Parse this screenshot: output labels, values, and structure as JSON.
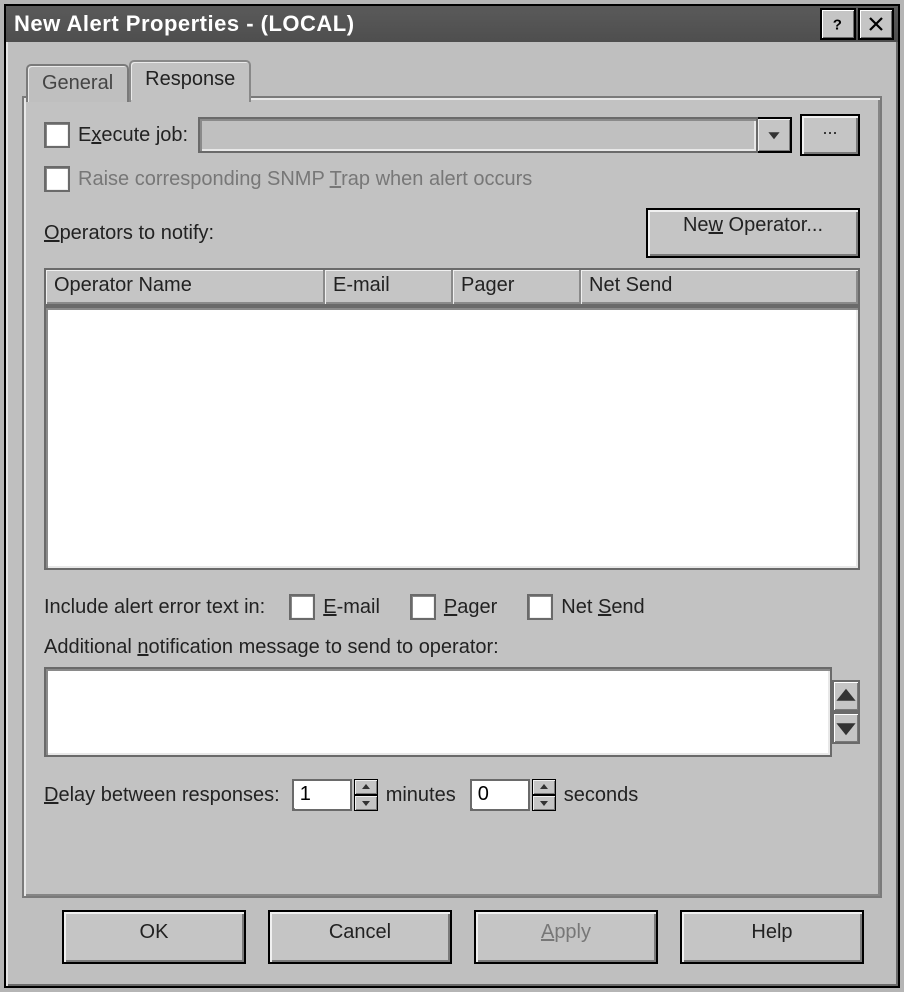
{
  "window": {
    "title": "New Alert Properties - (LOCAL)"
  },
  "tabs": {
    "general": "General",
    "response": "Response"
  },
  "response": {
    "execute_label": "Execute job:",
    "execute_value": "",
    "browse_label": "...",
    "snmp_label": "Raise corresponding SNMP Trap when alert occurs",
    "operators_label": "Operators to notify:",
    "new_operator_btn": "New Operator...",
    "columns": {
      "name": "Operator Name",
      "email": "E-mail",
      "pager": "Pager",
      "netsend": "Net Send"
    },
    "include_label": "Include alert error text in:",
    "include_email": "E-mail",
    "include_pager": "Pager",
    "include_netsend": "Net Send",
    "addl_msg_label": "Additional notification message to send to operator:",
    "addl_msg_value": "",
    "delay_label": "Delay between responses:",
    "delay_minutes": "1",
    "minutes_word": "minutes",
    "delay_seconds": "0",
    "seconds_word": "seconds"
  },
  "buttons": {
    "ok": "OK",
    "cancel": "Cancel",
    "apply": "Apply",
    "help": "Help"
  }
}
